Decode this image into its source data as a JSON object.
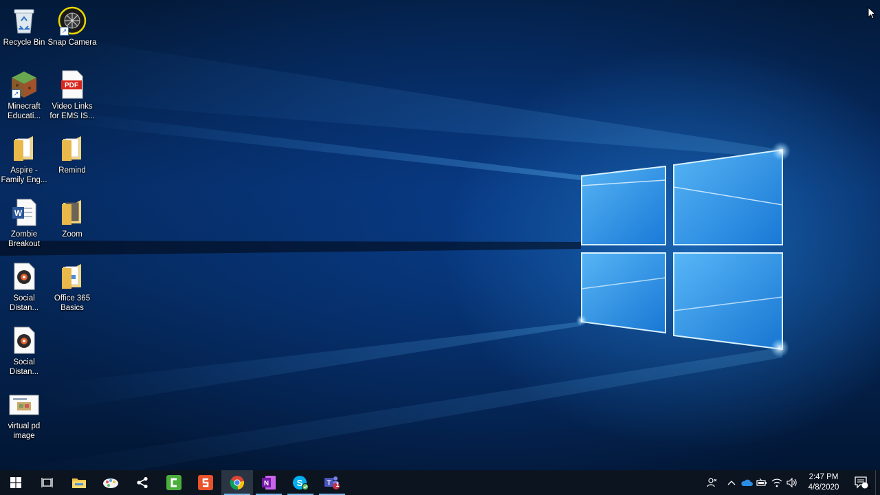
{
  "desktop": {
    "icons": [
      {
        "label": "Recycle Bin",
        "icon": "recycle-bin-icon"
      },
      {
        "label": "Snap Camera",
        "icon": "snap-camera-icon"
      },
      {
        "label": "Minecraft Educati...",
        "icon": "minecraft-icon"
      },
      {
        "label": "Video Links for EMS IS...",
        "icon": "pdf-icon"
      },
      {
        "label": "Aspire - Family Eng...",
        "icon": "folder-icon"
      },
      {
        "label": "Remind",
        "icon": "folder-icon"
      },
      {
        "label": "Zombie Breakout",
        "icon": "word-document-icon"
      },
      {
        "label": "Zoom",
        "icon": "folder-icon"
      },
      {
        "label": "Social Distan...",
        "icon": "media-file-icon"
      },
      {
        "label": "Office 365 Basics",
        "icon": "folder-icon"
      },
      {
        "label": "Social Distan...",
        "icon": "media-file-icon"
      },
      {
        "label": "virtual pd image",
        "icon": "image-thumbnail-icon"
      }
    ]
  },
  "taskbar": {
    "buttons": [
      {
        "name": "start",
        "icon": "windows-logo-icon"
      },
      {
        "name": "task-view",
        "icon": "task-view-icon"
      },
      {
        "name": "file-explorer",
        "icon": "folder-icon"
      },
      {
        "name": "paint-3d",
        "icon": "paint-palette-icon"
      },
      {
        "name": "share",
        "icon": "share-nodes-icon"
      },
      {
        "name": "camtasia",
        "icon": "camtasia-icon"
      },
      {
        "name": "snagit",
        "icon": "snagit-icon"
      },
      {
        "name": "chrome",
        "icon": "chrome-icon",
        "active": true
      },
      {
        "name": "onenote",
        "icon": "onenote-icon"
      },
      {
        "name": "skype",
        "icon": "skype-icon"
      },
      {
        "name": "teams",
        "icon": "teams-icon",
        "badge": "1"
      }
    ],
    "tray": {
      "icons": [
        "people-icon",
        "chevron-up-icon",
        "onedrive-cloud-icon",
        "battery-icon",
        "wifi-icon",
        "volume-icon"
      ],
      "time": "2:47 PM",
      "date": "4/8/2020",
      "notification_count": "1"
    },
    "colors": {
      "accent": "#76b9ed",
      "background": "#0c1420"
    }
  }
}
